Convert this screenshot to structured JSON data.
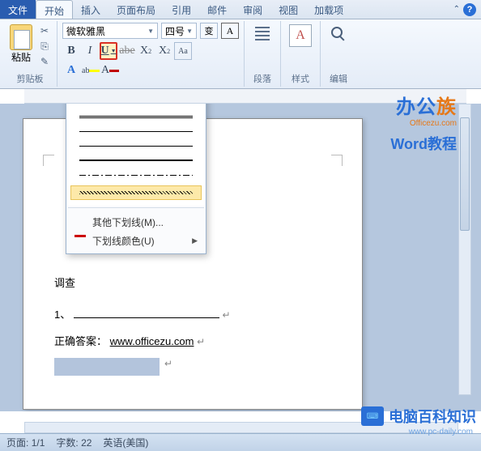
{
  "tabs": {
    "file": "文件",
    "items": [
      "开始",
      "插入",
      "页面布局",
      "引用",
      "邮件",
      "审阅",
      "视图",
      "加载项"
    ],
    "active_index": 0
  },
  "ribbon": {
    "clipboard": {
      "paste": "粘贴",
      "label": "剪贴板"
    },
    "font": {
      "name": "微软雅黑",
      "size": "四号",
      "ruby": "变",
      "charborder": "A",
      "bold": "B",
      "italic": "I",
      "underline": "U",
      "strike": "abe",
      "x2sub": "X",
      "x2sup": "X",
      "clearfmt": "Aa",
      "highlight": "ab",
      "fontcolor": "A"
    },
    "paragraph": {
      "label": "段落"
    },
    "styles": {
      "glyph": "A",
      "label": "样式"
    },
    "editing": {
      "label": "编辑"
    }
  },
  "dropdown": {
    "more": "其他下划线(M)...",
    "color": "下划线颜色(U)"
  },
  "document": {
    "line1": "调查",
    "line2_prefix": "1、",
    "answer_label": "正确答案：",
    "answer_link": "www.officezu.com",
    "pilcrow": "↵"
  },
  "watermark1": {
    "brand_a": "办公",
    "brand_b": "族",
    "domain": "Officezu.com",
    "sub": "Word教程"
  },
  "watermark2": {
    "text": "电脑百科知识",
    "url": "www.pc-daily.com",
    "logo": "⌨"
  },
  "status": {
    "page_label": "页面:",
    "page_val": "1/1",
    "words_label": "字数:",
    "words_val": "22",
    "lang": "英语(美国)"
  }
}
